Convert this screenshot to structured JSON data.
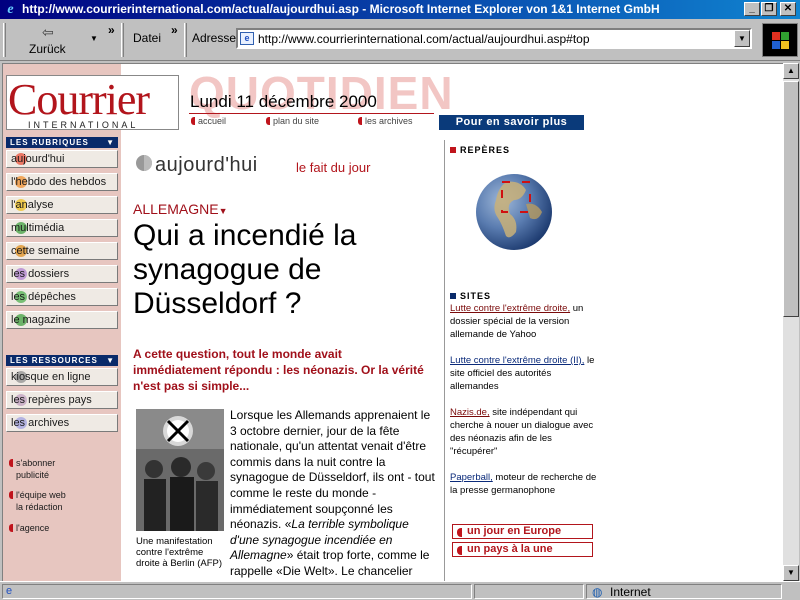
{
  "window": {
    "title": "http://www.courrierinternational.com/actual/aujourdhui.asp - Microsoft Internet Explorer von 1&1 Internet GmbH",
    "minimize": "_",
    "maximize": "❐",
    "close": "✕"
  },
  "toolbar": {
    "back_label": "Zurück",
    "file_menu": "Datei",
    "address_label": "Adresse",
    "address_value": "http://www.courrierinternational.com/actual/aujourdhui.asp#top"
  },
  "logo": {
    "wordmark": "Courrier",
    "subline": "INTERNATIONAL"
  },
  "header": {
    "banner": "QUOTIDIEN",
    "date": "Lundi 11 décembre 2000",
    "links": [
      "accueil",
      "plan du site",
      "les archives"
    ],
    "more_button": "Pour en savoir plus"
  },
  "sidebar": {
    "rubriques_title": "LES RUBRIQUES",
    "rubriques": [
      {
        "label": "aujourd'hui",
        "dot": "#e8503a"
      },
      {
        "label": "l'hebdo des hebdos",
        "dot": "#f09030"
      },
      {
        "label": "l'analyse",
        "dot": "#f0c020"
      },
      {
        "label": "multimédia",
        "dot": "#40a040"
      },
      {
        "label": "cette semaine",
        "dot": "#e09020"
      },
      {
        "label": "les dossiers",
        "dot": "#b080d0"
      },
      {
        "label": "les dépêches",
        "dot": "#50b050"
      },
      {
        "label": "le magazine",
        "dot": "#40a040"
      }
    ],
    "ressources_title": "LES RESSOURCES",
    "ressources": [
      {
        "label": "kiosque en ligne",
        "dot": "#909090"
      },
      {
        "label": "les repères pays",
        "dot": "#c0a0c0"
      },
      {
        "label": "les archives",
        "dot": "#a0a0e0"
      }
    ],
    "small_links": [
      "s'abonner",
      "publicité",
      "l'équipe web",
      "la rédaction",
      "l'agence"
    ]
  },
  "article": {
    "section_title": "aujourd'hui",
    "section_subtitle": "le fait du jour",
    "country": "ALLEMAGNE",
    "headline": "Qui a incendié la synagogue de Düsseldorf ?",
    "lead": "A cette question, tout le monde avait immédiatement répondu : les néonazis. Or la vérité n'est pas si simple...",
    "body_part1": "Lorsque les Allemands apprenaient le 3 octobre dernier, jour de la fête nationale, qu'un attentat venait d'être commis dans la nuit contre la synagogue de Düsseldorf, ils ont - tout comme le reste du monde - immédiatement soupçonné les néonazis. «",
    "body_italic": "La terrible symbolique d'une synagogue incendiée en Allemagne",
    "body_part2": "» était trop forte, comme le rappelle «Die Welt». Le chancelier Gerhard Schröder lui-",
    "photo_caption": "Une manifestation contre l'extrême droite à Berlin (AFP)"
  },
  "right": {
    "reperes_title": "REPÈRES",
    "sites_title": "SITES",
    "sites": [
      {
        "link": "Lutte contre l'extrême droite,",
        "text": " un dossier spécial de la version allemande de Yahoo"
      },
      {
        "link": "Lutte contre l'extrême droite (II),",
        "text": " le site officiel des autorités allemandes"
      },
      {
        "link": "Nazis.de,",
        "text": " site indépendant qui cherche à nouer un dialogue avec des néonazis afin de les \"récupérer\""
      },
      {
        "link": "Paperball,",
        "text": " moteur de recherche de la presse germanophone"
      }
    ],
    "buttons": [
      "un jour en Europe",
      "un pays à la une"
    ]
  },
  "status": {
    "zone": "Internet"
  },
  "colors": {
    "brand_red": "#b2151c",
    "nav_blue": "#0a2a6a",
    "sidebar_bg": "#e7c6c0"
  }
}
